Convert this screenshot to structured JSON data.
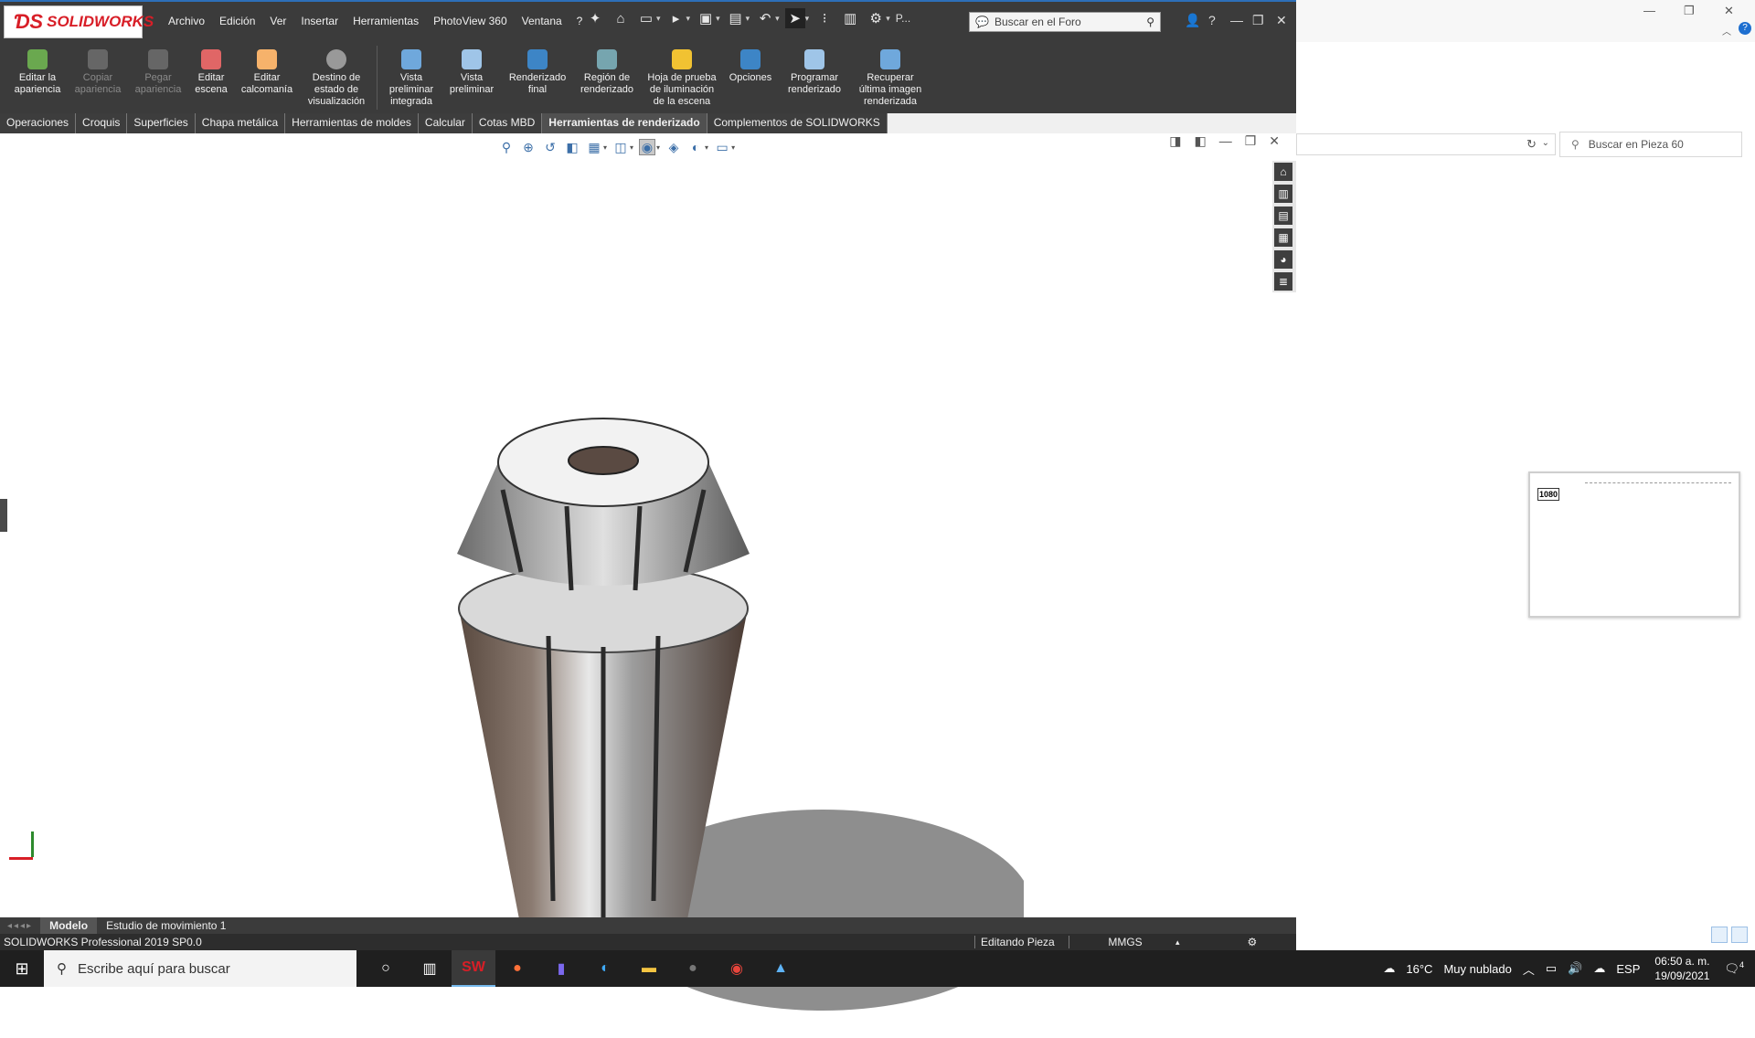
{
  "app": {
    "logo_text": "SOLIDWORKS",
    "menu": [
      "Archivo",
      "Edición",
      "Ver",
      "Insertar",
      "Herramientas",
      "PhotoView 360",
      "Ventana",
      "?"
    ],
    "quick_label_p": "P...",
    "forum_placeholder": "Buscar en el Foro"
  },
  "ribbon": {
    "buttons": [
      {
        "label": "Editar la apariencia",
        "enabled": true
      },
      {
        "label": "Copiar apariencia",
        "enabled": false
      },
      {
        "label": "Pegar apariencia",
        "enabled": false
      },
      {
        "label": "Editar escena",
        "enabled": true
      },
      {
        "label": "Editar calcomanía",
        "enabled": true
      },
      {
        "label": "Destino de estado de visualización",
        "enabled": true
      },
      {
        "label": "Vista preliminar integrada",
        "enabled": true
      },
      {
        "label": "Vista preliminar",
        "enabled": true
      },
      {
        "label": "Renderizado final",
        "enabled": true
      },
      {
        "label": "Región de renderizado",
        "enabled": true
      },
      {
        "label": "Hoja de prueba de iluminación de la escena",
        "enabled": true
      },
      {
        "label": "Opciones",
        "enabled": true
      },
      {
        "label": "Programar renderizado",
        "enabled": true
      },
      {
        "label": "Recuperar última imagen renderizada",
        "enabled": true
      }
    ]
  },
  "command_tabs": [
    {
      "label": "Operaciones",
      "active": false
    },
    {
      "label": "Croquis",
      "active": false
    },
    {
      "label": "Superficies",
      "active": false
    },
    {
      "label": "Chapa metálica",
      "active": false
    },
    {
      "label": "Herramientas de moldes",
      "active": false
    },
    {
      "label": "Calcular",
      "active": false
    },
    {
      "label": "Cotas MBD",
      "active": false
    },
    {
      "label": "Herramientas de renderizado",
      "active": true
    },
    {
      "label": "Complementos de SOLIDWORKS",
      "active": false
    }
  ],
  "bottom_tabs": [
    {
      "label": "Modelo",
      "active": true
    },
    {
      "label": "Estudio de movimiento 1",
      "active": false
    }
  ],
  "status": {
    "product": "SOLIDWORKS Professional 2019 SP0.0",
    "mode": "Editando Pieza",
    "units": "MMGS"
  },
  "explorer": {
    "search_placeholder": "Buscar en Pieza 60",
    "preview_label": "1080"
  },
  "taskbar": {
    "search_placeholder": "Escribe aquí para buscar",
    "weather_temp": "16°C",
    "weather_desc": "Muy nublado",
    "language": "ESP",
    "time": "06:50 a. m.",
    "date": "19/09/2021",
    "notifications": "4"
  },
  "colors": {
    "brand": "#d81e27",
    "chrome": "#3b3b3b",
    "accent": "#2d6fb9"
  }
}
